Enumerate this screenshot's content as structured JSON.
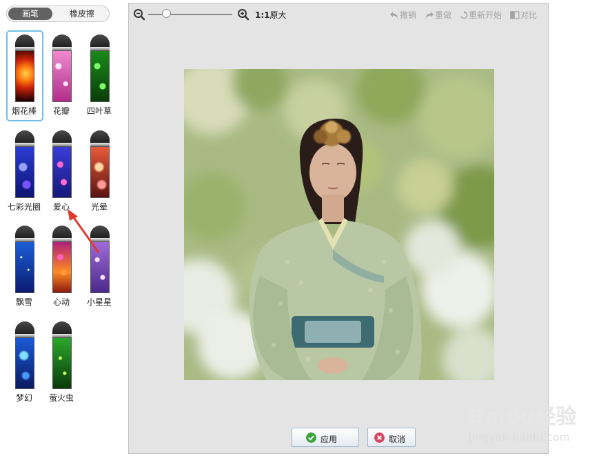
{
  "tabs": {
    "brush": "画笔",
    "eraser": "橡皮擦"
  },
  "brushes": [
    {
      "label": "烟花棒",
      "selected": true
    },
    {
      "label": "花瓣",
      "selected": false
    },
    {
      "label": "四叶草",
      "selected": false
    },
    {
      "label": "七彩光圈",
      "selected": false
    },
    {
      "label": "爱心",
      "selected": false
    },
    {
      "label": "光晕",
      "selected": false
    },
    {
      "label": "飘雪",
      "selected": false
    },
    {
      "label": "心动",
      "selected": false
    },
    {
      "label": "小星星",
      "selected": false
    },
    {
      "label": "梦幻",
      "selected": false
    },
    {
      "label": "萤火虫",
      "selected": false
    }
  ],
  "toolbar": {
    "ratio_bold": "1:1",
    "ratio_text": "原大",
    "undo": "撤销",
    "redo": "重做",
    "restart": "重新开始",
    "compare": "对比",
    "zoom_level": 0.27
  },
  "buttons": {
    "apply": "应用",
    "cancel": "取消"
  },
  "watermark": {
    "brand_text": "Baidu经验",
    "url": "jingyan.baidu.com"
  },
  "colors": {
    "selection": "#6ec0e8",
    "apply_icon": "#3aa33a",
    "cancel_icon": "#d9455f",
    "annotation_arrow": "#e03a2c"
  },
  "icons": [
    "zoom-out-icon",
    "zoom-in-icon",
    "undo-icon",
    "redo-icon",
    "restart-icon",
    "compare-icon",
    "check-icon",
    "x-icon"
  ]
}
